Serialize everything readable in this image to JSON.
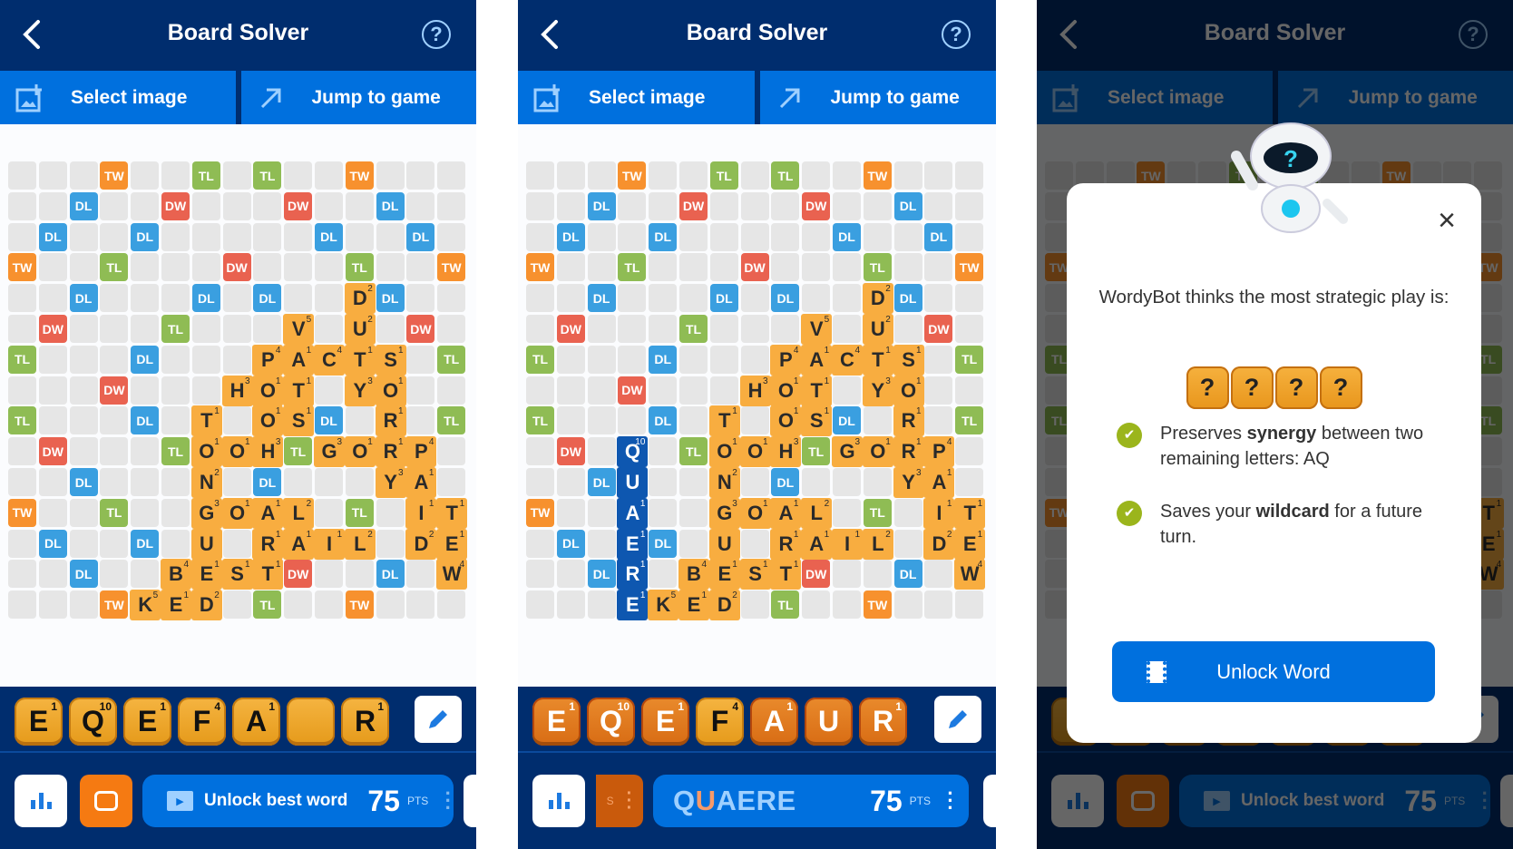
{
  "app": {
    "title": "Board Solver",
    "select_image": "Select image",
    "jump_to_game": "Jump to game",
    "help": "?",
    "back": "‹",
    "colors": {
      "navy": "#002d6e",
      "blue": "#0070de",
      "tile": "#f8ad40",
      "tw": "#f7912e",
      "tl": "#8fbc54",
      "dl": "#3a9fe0",
      "dw": "#e96250"
    }
  },
  "board": {
    "premium": [
      [
        0,
        3,
        "TW"
      ],
      [
        0,
        6,
        "TL"
      ],
      [
        0,
        8,
        "TL"
      ],
      [
        0,
        11,
        "TW"
      ],
      [
        1,
        2,
        "DL"
      ],
      [
        1,
        5,
        "DW"
      ],
      [
        1,
        9,
        "DW"
      ],
      [
        1,
        12,
        "DL"
      ],
      [
        2,
        1,
        "DL"
      ],
      [
        2,
        4,
        "DL"
      ],
      [
        2,
        10,
        "DL"
      ],
      [
        2,
        13,
        "DL"
      ],
      [
        3,
        0,
        "TW"
      ],
      [
        3,
        3,
        "TL"
      ],
      [
        3,
        7,
        "DW"
      ],
      [
        3,
        11,
        "TL"
      ],
      [
        3,
        14,
        "TW"
      ],
      [
        4,
        2,
        "DL"
      ],
      [
        4,
        6,
        "DL"
      ],
      [
        4,
        8,
        "DL"
      ],
      [
        4,
        12,
        "DL"
      ],
      [
        5,
        1,
        "DW"
      ],
      [
        5,
        5,
        "TL"
      ],
      [
        5,
        13,
        "DW"
      ],
      [
        6,
        0,
        "TL"
      ],
      [
        6,
        4,
        "DL"
      ],
      [
        6,
        14,
        "TL"
      ],
      [
        7,
        3,
        "DW"
      ],
      [
        8,
        0,
        "TL"
      ],
      [
        8,
        4,
        "DL"
      ],
      [
        8,
        10,
        "DL"
      ],
      [
        8,
        14,
        "TL"
      ],
      [
        9,
        1,
        "DW"
      ],
      [
        9,
        5,
        "TL"
      ],
      [
        9,
        9,
        "TL"
      ],
      [
        10,
        2,
        "DL"
      ],
      [
        10,
        8,
        "DL"
      ],
      [
        11,
        0,
        "TW"
      ],
      [
        11,
        3,
        "TL"
      ],
      [
        11,
        11,
        "TL"
      ],
      [
        12,
        1,
        "DL"
      ],
      [
        12,
        4,
        "DL"
      ],
      [
        13,
        2,
        "DL"
      ],
      [
        13,
        9,
        "DW"
      ],
      [
        13,
        12,
        "DL"
      ],
      [
        14,
        3,
        "TW"
      ],
      [
        14,
        8,
        "TL"
      ],
      [
        14,
        11,
        "TW"
      ]
    ],
    "tiles": [
      [
        4,
        11,
        "D",
        "2"
      ],
      [
        5,
        9,
        "V",
        "5"
      ],
      [
        5,
        11,
        "U",
        "2"
      ],
      [
        6,
        8,
        "P",
        "4"
      ],
      [
        6,
        9,
        "A",
        "1"
      ],
      [
        6,
        10,
        "C",
        "4"
      ],
      [
        6,
        11,
        "T",
        "1"
      ],
      [
        6,
        12,
        "S",
        "1"
      ],
      [
        7,
        7,
        "H",
        "3"
      ],
      [
        7,
        8,
        "O",
        "1"
      ],
      [
        7,
        9,
        "T",
        "1"
      ],
      [
        7,
        11,
        "Y",
        "3"
      ],
      [
        7,
        12,
        "O",
        "1"
      ],
      [
        8,
        6,
        "T",
        "1"
      ],
      [
        8,
        8,
        "O",
        "1"
      ],
      [
        8,
        9,
        "S",
        "1"
      ],
      [
        8,
        12,
        "R",
        "1"
      ],
      [
        9,
        6,
        "O",
        "1"
      ],
      [
        9,
        7,
        "O",
        "1"
      ],
      [
        9,
        8,
        "H",
        "3"
      ],
      [
        9,
        10,
        "G",
        "3"
      ],
      [
        9,
        11,
        "O",
        "1"
      ],
      [
        9,
        12,
        "R",
        "1"
      ],
      [
        9,
        13,
        "P",
        "4"
      ],
      [
        10,
        6,
        "N",
        "2"
      ],
      [
        10,
        12,
        "Y",
        "3"
      ],
      [
        10,
        13,
        "A",
        "1"
      ],
      [
        11,
        6,
        "G",
        "3"
      ],
      [
        11,
        7,
        "O",
        "1"
      ],
      [
        11,
        8,
        "A",
        "1"
      ],
      [
        11,
        9,
        "L",
        "2"
      ],
      [
        11,
        13,
        "I",
        "1"
      ],
      [
        11,
        14,
        "T",
        "1"
      ],
      [
        12,
        6,
        "U",
        ""
      ],
      [
        12,
        8,
        "R",
        "1"
      ],
      [
        12,
        9,
        "A",
        "1"
      ],
      [
        12,
        10,
        "I",
        "1"
      ],
      [
        12,
        11,
        "L",
        "2"
      ],
      [
        12,
        13,
        "D",
        "2"
      ],
      [
        12,
        14,
        "E",
        "1"
      ],
      [
        13,
        5,
        "B",
        "4"
      ],
      [
        13,
        6,
        "E",
        "1"
      ],
      [
        13,
        7,
        "S",
        "1"
      ],
      [
        13,
        8,
        "T",
        "1"
      ],
      [
        13,
        14,
        "W",
        "4"
      ],
      [
        14,
        4,
        "K",
        "5"
      ],
      [
        14,
        5,
        "E",
        "1"
      ],
      [
        14,
        6,
        "D",
        "2"
      ]
    ],
    "suggested_tiles": [
      [
        9,
        3,
        "Q",
        "10"
      ],
      [
        10,
        3,
        "U",
        ""
      ],
      [
        11,
        3,
        "A",
        "1"
      ],
      [
        12,
        3,
        "E",
        "1"
      ],
      [
        13,
        3,
        "R",
        "1"
      ],
      [
        14,
        3,
        "E",
        "1"
      ]
    ]
  },
  "panel1": {
    "rack": [
      {
        "letter": "E",
        "points": "1"
      },
      {
        "letter": "Q",
        "points": "10"
      },
      {
        "letter": "E",
        "points": "1"
      },
      {
        "letter": "F",
        "points": "4"
      },
      {
        "letter": "A",
        "points": "1"
      },
      {
        "letter": "",
        "points": ""
      },
      {
        "letter": "R",
        "points": "1"
      }
    ],
    "unlock_label": "Unlock best word",
    "points": "75",
    "pts_label": "PTS"
  },
  "panel2": {
    "rack": [
      {
        "letter": "E",
        "points": "1",
        "used": true
      },
      {
        "letter": "Q",
        "points": "10",
        "used": true
      },
      {
        "letter": "E",
        "points": "1",
        "used": true
      },
      {
        "letter": "F",
        "points": "4",
        "used": false
      },
      {
        "letter": "A",
        "points": "1",
        "used": true
      },
      {
        "letter": "U",
        "points": "",
        "used": true
      },
      {
        "letter": "R",
        "points": "1",
        "used": true
      }
    ],
    "word_parts": [
      "Q",
      "U",
      "AERE"
    ],
    "points": "75",
    "pts_label": "PTS",
    "prev_card_text": "S"
  },
  "panel3": {
    "modal_text": "WordyBot thinks the most strategic play is:",
    "hidden_tiles": [
      "?",
      "?",
      "?",
      "?"
    ],
    "reasons": [
      {
        "pre": "Preserves ",
        "bold": "synergy",
        "post": " between two remaining letters: AQ"
      },
      {
        "pre": "Saves your ",
        "bold": "wildcard",
        "post": " for a future turn."
      }
    ],
    "button": "Unlock Word",
    "close": "×",
    "robot_face": "?",
    "unlock_label": "Unlock best word",
    "points": "75",
    "pts_label": "PTS"
  }
}
